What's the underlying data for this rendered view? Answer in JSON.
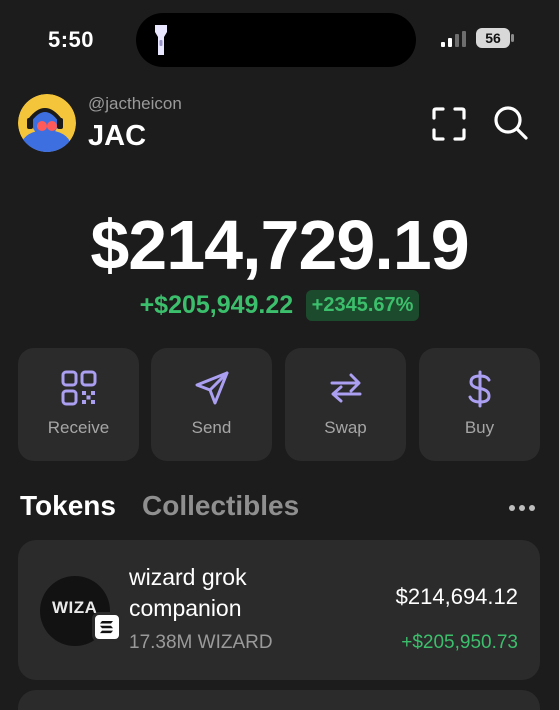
{
  "status": {
    "time": "5:50",
    "battery": "56"
  },
  "account": {
    "handle": "@jactheicon",
    "name": "JAC"
  },
  "portfolio": {
    "balance": "$214,729.19",
    "change_abs": "+$205,949.22",
    "change_pct": "+2345.67%"
  },
  "actions": [
    {
      "label": "Receive",
      "icon": "qr-code-icon"
    },
    {
      "label": "Send",
      "icon": "send-icon"
    },
    {
      "label": "Swap",
      "icon": "swap-icon"
    },
    {
      "label": "Buy",
      "icon": "dollar-icon"
    }
  ],
  "tabs": {
    "tokens": "Tokens",
    "collectibles": "Collectibles"
  },
  "tokens": [
    {
      "logo_text": "WIZA",
      "name": "wizard grok companion",
      "amount": "17.38M WIZARD",
      "value": "$214,694.12",
      "change": "+$205,950.73"
    }
  ],
  "colors": {
    "accent": "#ab9ff2",
    "positive": "#3cbf6c",
    "card": "#2b2b2b",
    "background": "#1c1c1c"
  }
}
